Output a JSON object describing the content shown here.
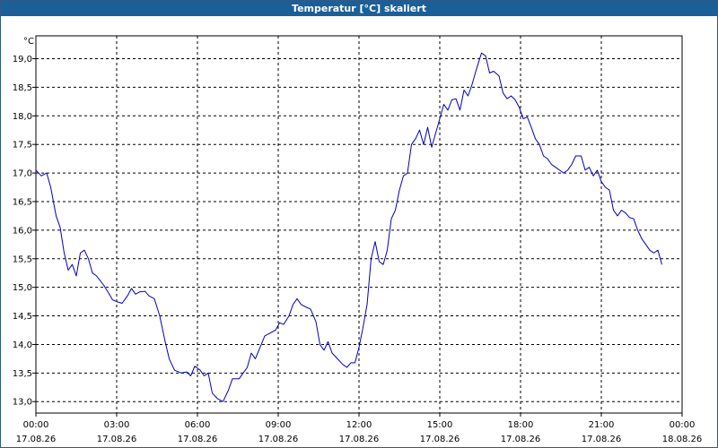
{
  "window": {
    "title": "Temperatur [°C] skaliert"
  },
  "chart_data": {
    "type": "line",
    "title": "Temperatur [°C] skaliert",
    "ylabel": "°C",
    "xlabel": "",
    "ylim": [
      12.8,
      19.4
    ],
    "xlim": [
      0,
      24
    ],
    "grid": true,
    "yticks": [
      13.0,
      13.5,
      14.0,
      14.5,
      15.0,
      15.5,
      16.0,
      16.5,
      17.0,
      17.5,
      18.0,
      18.5,
      19.0
    ],
    "ytick_labels": [
      "13,0",
      "13,5",
      "14,0",
      "14,5",
      "15,0",
      "15,5",
      "16,0",
      "16,5",
      "17,0",
      "17,5",
      "18,0",
      "18,5",
      "19,0"
    ],
    "xticks": [
      {
        "time": "00:00",
        "date": "17.08.26"
      },
      {
        "time": "03:00",
        "date": "17.08.26"
      },
      {
        "time": "06:00",
        "date": "17.08.26"
      },
      {
        "time": "09:00",
        "date": "17.08.26"
      },
      {
        "time": "12:00",
        "date": "17.08.26"
      },
      {
        "time": "15:00",
        "date": "17.08.26"
      },
      {
        "time": "18:00",
        "date": "17.08.26"
      },
      {
        "time": "21:00",
        "date": "17.08.26"
      },
      {
        "time": "00:00",
        "date": "18.08.26"
      }
    ],
    "line_color": "#0000c0",
    "series": [
      {
        "values": [
          [
            0.0,
            17.05
          ],
          [
            0.2,
            16.95
          ],
          [
            0.4,
            17.0
          ],
          [
            0.55,
            16.75
          ],
          [
            0.75,
            16.25
          ],
          [
            0.9,
            16.05
          ],
          [
            1.05,
            15.6
          ],
          [
            1.2,
            15.3
          ],
          [
            1.35,
            15.4
          ],
          [
            1.5,
            15.2
          ],
          [
            1.65,
            15.6
          ],
          [
            1.8,
            15.65
          ],
          [
            1.95,
            15.5
          ],
          [
            2.1,
            15.25
          ],
          [
            2.25,
            15.2
          ],
          [
            2.5,
            15.05
          ],
          [
            2.7,
            14.9
          ],
          [
            2.85,
            14.78
          ],
          [
            3.0,
            14.75
          ],
          [
            3.2,
            14.72
          ],
          [
            3.4,
            14.85
          ],
          [
            3.55,
            14.98
          ],
          [
            3.7,
            14.88
          ],
          [
            3.85,
            14.92
          ],
          [
            4.05,
            14.93
          ],
          [
            4.2,
            14.85
          ],
          [
            4.4,
            14.8
          ],
          [
            4.6,
            14.5
          ],
          [
            4.8,
            14.05
          ],
          [
            4.95,
            13.75
          ],
          [
            5.15,
            13.55
          ],
          [
            5.4,
            13.5
          ],
          [
            5.6,
            13.52
          ],
          [
            5.75,
            13.45
          ],
          [
            5.9,
            13.62
          ],
          [
            6.1,
            13.55
          ],
          [
            6.25,
            13.45
          ],
          [
            6.4,
            13.5
          ],
          [
            6.55,
            13.15
          ],
          [
            6.75,
            13.05
          ],
          [
            6.95,
            13.0
          ],
          [
            7.15,
            13.2
          ],
          [
            7.3,
            13.4
          ],
          [
            7.55,
            13.4
          ],
          [
            7.7,
            13.5
          ],
          [
            7.85,
            13.6
          ],
          [
            8.0,
            13.85
          ],
          [
            8.15,
            13.75
          ],
          [
            8.3,
            13.92
          ],
          [
            8.5,
            14.15
          ],
          [
            8.7,
            14.2
          ],
          [
            8.9,
            14.25
          ],
          [
            9.05,
            14.38
          ],
          [
            9.2,
            14.35
          ],
          [
            9.4,
            14.5
          ],
          [
            9.55,
            14.7
          ],
          [
            9.7,
            14.8
          ],
          [
            9.85,
            14.7
          ],
          [
            10.05,
            14.65
          ],
          [
            10.2,
            14.62
          ],
          [
            10.4,
            14.4
          ],
          [
            10.55,
            14.0
          ],
          [
            10.7,
            13.9
          ],
          [
            10.85,
            14.05
          ],
          [
            11.0,
            13.85
          ],
          [
            11.2,
            13.75
          ],
          [
            11.4,
            13.65
          ],
          [
            11.55,
            13.6
          ],
          [
            11.7,
            13.68
          ],
          [
            11.85,
            13.68
          ],
          [
            12.0,
            13.95
          ],
          [
            12.15,
            14.3
          ],
          [
            12.3,
            14.7
          ],
          [
            12.45,
            15.5
          ],
          [
            12.6,
            15.8
          ],
          [
            12.75,
            15.45
          ],
          [
            12.9,
            15.4
          ],
          [
            13.05,
            15.65
          ],
          [
            13.2,
            16.2
          ],
          [
            13.35,
            16.35
          ],
          [
            13.5,
            16.7
          ],
          [
            13.65,
            16.95
          ],
          [
            13.8,
            17.0
          ],
          [
            13.95,
            17.5
          ],
          [
            14.1,
            17.6
          ],
          [
            14.25,
            17.75
          ],
          [
            14.4,
            17.5
          ],
          [
            14.55,
            17.8
          ],
          [
            14.7,
            17.45
          ],
          [
            14.85,
            17.7
          ],
          [
            15.0,
            17.95
          ],
          [
            15.15,
            18.2
          ],
          [
            15.3,
            18.1
          ],
          [
            15.45,
            18.28
          ],
          [
            15.6,
            18.3
          ],
          [
            15.75,
            18.1
          ],
          [
            15.9,
            18.45
          ],
          [
            16.05,
            18.35
          ],
          [
            16.2,
            18.55
          ],
          [
            16.35,
            18.8
          ],
          [
            16.55,
            19.1
          ],
          [
            16.7,
            19.05
          ],
          [
            16.85,
            18.75
          ],
          [
            17.0,
            18.78
          ],
          [
            17.2,
            18.7
          ],
          [
            17.35,
            18.4
          ],
          [
            17.5,
            18.3
          ],
          [
            17.65,
            18.35
          ],
          [
            17.8,
            18.28
          ],
          [
            17.95,
            18.15
          ],
          [
            18.1,
            17.95
          ],
          [
            18.25,
            17.98
          ],
          [
            18.4,
            17.8
          ],
          [
            18.55,
            17.6
          ],
          [
            18.7,
            17.5
          ],
          [
            18.85,
            17.3
          ],
          [
            19.0,
            17.25
          ],
          [
            19.15,
            17.15
          ],
          [
            19.3,
            17.1
          ],
          [
            19.45,
            17.05
          ],
          [
            19.6,
            17.0
          ],
          [
            19.75,
            17.05
          ],
          [
            19.9,
            17.15
          ],
          [
            20.05,
            17.3
          ],
          [
            20.25,
            17.3
          ],
          [
            20.4,
            17.05
          ],
          [
            20.55,
            17.1
          ],
          [
            20.7,
            16.95
          ],
          [
            20.85,
            17.05
          ],
          [
            21.0,
            16.85
          ],
          [
            21.15,
            16.75
          ],
          [
            21.3,
            16.7
          ],
          [
            21.45,
            16.35
          ],
          [
            21.6,
            16.25
          ],
          [
            21.75,
            16.35
          ],
          [
            21.9,
            16.3
          ],
          [
            22.05,
            16.22
          ],
          [
            22.2,
            16.2
          ],
          [
            22.35,
            16.0
          ],
          [
            22.5,
            15.85
          ],
          [
            22.65,
            15.75
          ],
          [
            22.8,
            15.65
          ],
          [
            22.95,
            15.6
          ],
          [
            23.1,
            15.65
          ],
          [
            23.25,
            15.4
          ]
        ]
      }
    ]
  }
}
